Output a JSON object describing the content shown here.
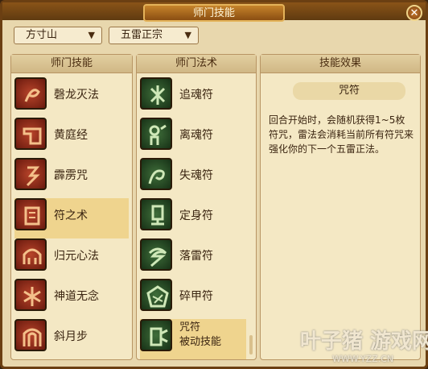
{
  "window": {
    "title": "师门技能",
    "close_glyph": "✕"
  },
  "filters": {
    "sect": "方寸山",
    "school": "五雷正宗",
    "arrow_glyph": "▼"
  },
  "skills_panel": {
    "header": "师门技能",
    "items": [
      {
        "label": "磬龙灭法",
        "icon": "dragon-icon"
      },
      {
        "label": "黄庭经",
        "icon": "scroll-icon"
      },
      {
        "label": "霹雳咒",
        "icon": "lightning-icon"
      },
      {
        "label": "符之术",
        "icon": "talisman-icon",
        "selected": true
      },
      {
        "label": "归元心法",
        "icon": "helmet-icon"
      },
      {
        "label": "神道无念",
        "icon": "spirit-icon"
      },
      {
        "label": "斜月步",
        "icon": "arch-icon"
      }
    ]
  },
  "spells_panel": {
    "header": "师门法术",
    "items": [
      {
        "label": "追魂符",
        "icon": "chase-soul-icon"
      },
      {
        "label": "离魂符",
        "icon": "leave-soul-icon"
      },
      {
        "label": "失魂符",
        "icon": "lose-soul-icon"
      },
      {
        "label": "定身符",
        "icon": "freeze-icon"
      },
      {
        "label": "落雷符",
        "icon": "thunder-icon"
      },
      {
        "label": "碎甲符",
        "icon": "armor-break-icon"
      },
      {
        "label": "咒符",
        "sublabel": "被动技能",
        "icon": "curse-talisman-icon",
        "selected": true
      }
    ]
  },
  "effect_panel": {
    "header": "技能效果",
    "title": "咒符",
    "description": "回合开始时，会随机获得1~5枚符咒，雷法会消耗当前所有符咒来强化你的下一个五雷正法。"
  },
  "watermark": {
    "name": "叶子猪 游戏网",
    "url": "WWW.YZZ.CN"
  }
}
